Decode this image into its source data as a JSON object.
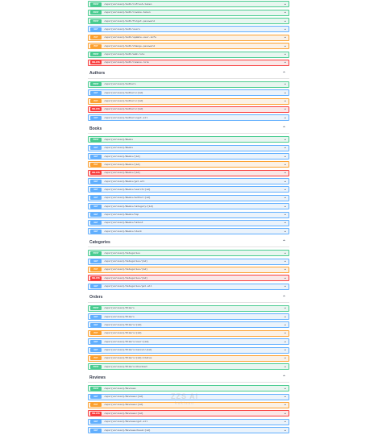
{
  "sections": [
    {
      "name": "",
      "ops": [
        {
          "method": "post",
          "label": "POST",
          "path": "/api/{version}/Auth/register"
        },
        {
          "method": "post",
          "label": "POST",
          "path": "/api/{version}/Auth/refresh-token"
        },
        {
          "method": "post",
          "label": "POST",
          "path": "/api/{version}/Auth/revoke-token"
        },
        {
          "method": "post",
          "label": "POST",
          "path": "/api/{version}/Auth/forgot-password"
        },
        {
          "method": "get",
          "label": "GET",
          "path": "/api/{version}/Auth/users"
        },
        {
          "method": "put",
          "label": "PUT",
          "path": "/api/{version}/Auth/update-user-info"
        },
        {
          "method": "put",
          "label": "PUT",
          "path": "/api/{version}/Auth/change-password"
        },
        {
          "method": "post",
          "label": "POST",
          "path": "/api/{version}/Auth/add-role"
        },
        {
          "method": "delete",
          "label": "DELETE",
          "path": "/api/{version}/Auth/remove-role"
        }
      ]
    },
    {
      "name": "Authors",
      "ops": [
        {
          "method": "post",
          "label": "POST",
          "path": "/api/{version}/Authors"
        },
        {
          "method": "get",
          "label": "GET",
          "path": "/api/{version}/Authors/{id}"
        },
        {
          "method": "put",
          "label": "PUT",
          "path": "/api/{version}/Authors/{id}"
        },
        {
          "method": "delete",
          "label": "DELETE",
          "path": "/api/{version}/Authors/{id}"
        },
        {
          "method": "get",
          "label": "GET",
          "path": "/api/{version}/Authors/get-all"
        }
      ]
    },
    {
      "name": "Books",
      "ops": [
        {
          "method": "post",
          "label": "POST",
          "path": "/api/{version}/Books"
        },
        {
          "method": "get",
          "label": "GET",
          "path": "/api/{version}/Books"
        },
        {
          "method": "get",
          "label": "GET",
          "path": "/api/{version}/Books/{id}"
        },
        {
          "method": "put",
          "label": "PUT",
          "path": "/api/{version}/Books/{id}"
        },
        {
          "method": "delete",
          "label": "DELETE",
          "path": "/api/{version}/Books/{id}"
        },
        {
          "method": "get",
          "label": "GET",
          "path": "/api/{version}/Books/get-all"
        },
        {
          "method": "get",
          "label": "GET",
          "path": "/api/{version}/Books/search/{id}"
        },
        {
          "method": "get",
          "label": "GET",
          "path": "/api/{version}/Books/author/{id}"
        },
        {
          "method": "get",
          "label": "GET",
          "path": "/api/{version}/Books/category/{id}"
        },
        {
          "method": "get",
          "label": "GET",
          "path": "/api/{version}/Books/top"
        },
        {
          "method": "get",
          "label": "GET",
          "path": "/api/{version}/Books/latest"
        },
        {
          "method": "get",
          "label": "GET",
          "path": "/api/{version}/Books/stock"
        }
      ]
    },
    {
      "name": "Categories",
      "ops": [
        {
          "method": "post",
          "label": "POST",
          "path": "/api/{version}/Categories"
        },
        {
          "method": "get",
          "label": "GET",
          "path": "/api/{version}/Categories/{id}"
        },
        {
          "method": "put",
          "label": "PUT",
          "path": "/api/{version}/Categories/{id}"
        },
        {
          "method": "delete",
          "label": "DELETE",
          "path": "/api/{version}/Categories/{id}"
        },
        {
          "method": "get",
          "label": "GET",
          "path": "/api/{version}/Categories/get-all"
        }
      ]
    },
    {
      "name": "Orders",
      "ops": [
        {
          "method": "post",
          "label": "POST",
          "path": "/api/{version}/Orders"
        },
        {
          "method": "get",
          "label": "GET",
          "path": "/api/{version}/Orders"
        },
        {
          "method": "get",
          "label": "GET",
          "path": "/api/{version}/Orders/{id}"
        },
        {
          "method": "put",
          "label": "PUT",
          "path": "/api/{version}/Orders/{id}"
        },
        {
          "method": "get",
          "label": "GET",
          "path": "/api/{version}/Orders/user/{id}"
        },
        {
          "method": "get",
          "label": "GET",
          "path": "/api/{version}/Orders/cancel/{id}"
        },
        {
          "method": "put",
          "label": "PUT",
          "path": "/api/{version}/Orders/{id}/status"
        },
        {
          "method": "post",
          "label": "POST",
          "path": "/api/{version}/Orders/checkout"
        }
      ]
    },
    {
      "name": "Reviews",
      "ops": [
        {
          "method": "post",
          "label": "POST",
          "path": "/api/{version}/Reviews"
        },
        {
          "method": "get",
          "label": "GET",
          "path": "/api/{version}/Reviews/{id}"
        },
        {
          "method": "put",
          "label": "PUT",
          "path": "/api/{version}/Reviews/{id}"
        },
        {
          "method": "delete",
          "label": "DELETE",
          "path": "/api/{version}/Reviews/{id}"
        },
        {
          "method": "get",
          "label": "GET",
          "path": "/api/{version}/Reviews/get-all"
        },
        {
          "method": "get",
          "label": "GET",
          "path": "/api/{version}/Reviews/book/{id}"
        }
      ]
    }
  ],
  "icons": {
    "section_chevron": "⌃",
    "op_chevron": "⌄"
  },
  "watermark": {
    "line1": "ZZS AI",
    "line2": "kukisuo"
  }
}
